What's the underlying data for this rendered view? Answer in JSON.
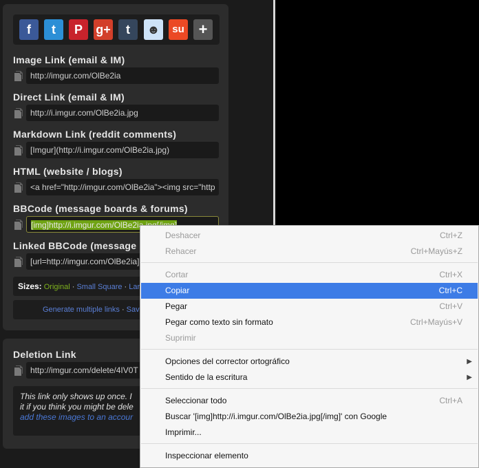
{
  "share": {
    "buttons": [
      {
        "name": "facebook-icon",
        "glyph": "f",
        "color": "#3b5998"
      },
      {
        "name": "twitter-icon",
        "glyph": "t",
        "color": "#2c8fd6"
      },
      {
        "name": "pinterest-icon",
        "glyph": "P",
        "color": "#c8232c"
      },
      {
        "name": "googleplus-icon",
        "glyph": "g+",
        "color": "#d23f2a"
      },
      {
        "name": "tumblr-icon",
        "glyph": "t",
        "color": "#35465c"
      },
      {
        "name": "reddit-icon",
        "glyph": "☻",
        "color": "#cee3f8"
      },
      {
        "name": "stumbleupon-icon",
        "glyph": "su",
        "color": "#eb4924"
      },
      {
        "name": "more-icon",
        "glyph": "+",
        "color": "#555555"
      }
    ]
  },
  "fields": [
    {
      "label": "Image Link (email & IM)",
      "value": "http://imgur.com/OlBe2ia"
    },
    {
      "label": "Direct Link (email & IM)",
      "value": "http://i.imgur.com/OlBe2ia.jpg"
    },
    {
      "label": "Markdown Link (reddit comments)",
      "value": "[Imgur](http://i.imgur.com/OlBe2ia.jpg)"
    },
    {
      "label": "HTML (website / blogs)",
      "value": "<a href=\"http://imgur.com/OlBe2ia\"><img src=\"http"
    },
    {
      "label": "BBCode (message boards & forums)",
      "value": "[img]http://i.imgur.com/OlBe2ia.jpg[/img]"
    },
    {
      "label": "Linked BBCode (message",
      "value": "[url=http://imgur.com/OlBe2ia]"
    }
  ],
  "sizes": {
    "label": "Sizes:",
    "original": "Original",
    "sep": " · ",
    "small_square": "Small Square",
    "large": "Larg"
  },
  "generate": {
    "text": "Generate multiple links",
    "sep": " · ",
    "save": "Save"
  },
  "deletion": {
    "label": "Deletion Link",
    "value": "http://imgur.com/delete/4IV0T",
    "note_line1": "This link only shows up once. I",
    "note_line2": "it if you think you might be dele",
    "note_link": "add these images to an accour"
  },
  "context_menu": {
    "items": [
      {
        "label": "Deshacer",
        "shortcut": "Ctrl+Z",
        "state": "disabled"
      },
      {
        "label": "Rehacer",
        "shortcut": "Ctrl+Mayús+Z",
        "state": "disabled"
      },
      {
        "label": "Cortar",
        "shortcut": "Ctrl+X",
        "state": "disabled"
      },
      {
        "label": "Copiar",
        "shortcut": "Ctrl+C",
        "state": "active"
      },
      {
        "label": "Pegar",
        "shortcut": "Ctrl+V",
        "state": "normal"
      },
      {
        "label": "Pegar como texto sin formato",
        "shortcut": "Ctrl+Mayús+V",
        "state": "normal"
      },
      {
        "label": "Suprimir",
        "shortcut": "",
        "state": "disabled"
      },
      {
        "label": "Opciones del corrector ortográfico",
        "shortcut": "",
        "state": "submenu"
      },
      {
        "label": "Sentido de la escritura",
        "shortcut": "",
        "state": "submenu"
      },
      {
        "label": "Seleccionar todo",
        "shortcut": "Ctrl+A",
        "state": "normal"
      },
      {
        "label": "Buscar '[img]http://i.imgur.com/OlBe2ia.jpg[/img]' con Google",
        "shortcut": "",
        "state": "normal"
      },
      {
        "label": "Imprimir...",
        "shortcut": "",
        "state": "normal"
      },
      {
        "label": "Inspeccionar elemento",
        "shortcut": "",
        "state": "normal"
      }
    ]
  }
}
